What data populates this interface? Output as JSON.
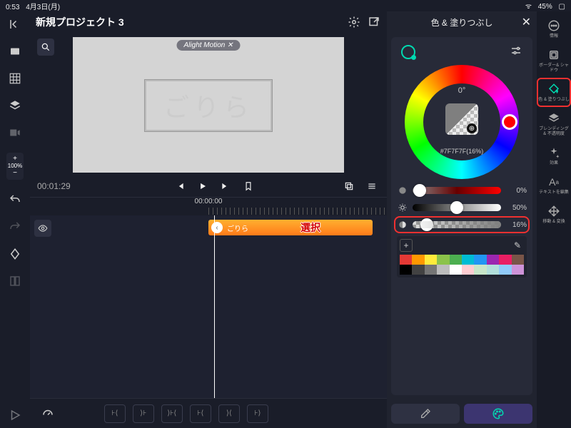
{
  "statusbar": {
    "time": "0:53",
    "date": "4月3日(月)",
    "battery": "45%"
  },
  "header": {
    "title": "新規プロジェクト 3 "
  },
  "zoom": {
    "plus": "+",
    "val": "100%",
    "minus": "−"
  },
  "preview": {
    "watermark": "Alight Motion ✕",
    "text": "ごりら"
  },
  "transport": {
    "tc": "00:01:29",
    "ruler_tc": "00:00:00"
  },
  "clip": {
    "label": "ごりら",
    "selection": "選択"
  },
  "panel": {
    "title": "色 & 塗りつぶし",
    "hue": "0°",
    "hex": "#7F7F7F(16%)",
    "sat": {
      "val": "0%",
      "pos": 8
    },
    "lig": {
      "val": "50%",
      "pos": 50
    },
    "opa": {
      "val": "16%",
      "pos": 16
    }
  },
  "palette_row1": [
    "#e53935",
    "#ff9800",
    "#ffeb3b",
    "#8bc34a",
    "#4caf50",
    "#00bcd4",
    "#2196f3",
    "#9c27b0",
    "#e91e63",
    "#795548"
  ],
  "palette_row2": [
    "#000000",
    "#424242",
    "#757575",
    "#bdbdbd",
    "#ffffff",
    "#ffcdd2",
    "#c8e6c9",
    "#b2dfdb",
    "#90caf9",
    "#ce93d8"
  ],
  "rightbar": {
    "info": "情報",
    "border": "ボーダー&\nシャドウ",
    "fill": "色 & 塗りつぶし",
    "blend": "ブレンディング\n& 不透明度",
    "effect": "効果",
    "text": "テキストを編集",
    "move": "移動 & 変換"
  }
}
